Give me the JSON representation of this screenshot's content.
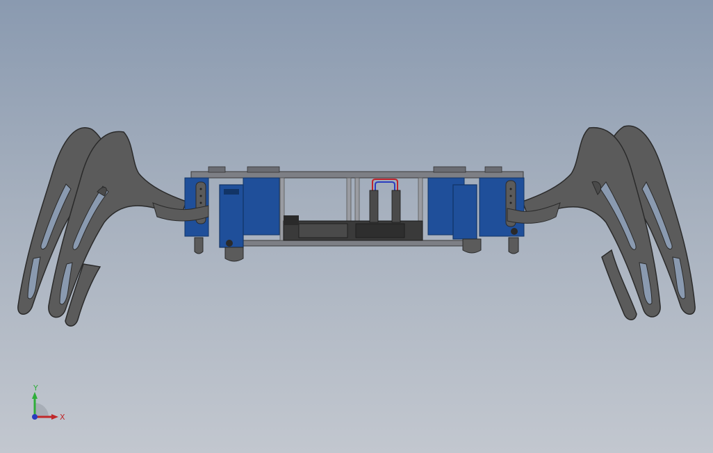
{
  "viewport": {
    "background_top": "#8a9ab0",
    "background_bottom": "#c2c7cf",
    "model": {
      "leg_color": "#5b5b5b",
      "leg_edge": "#2a2a2a",
      "servo_color": "#1f4f9a",
      "servo_dark": "#123466",
      "plate_color": "#7d7f85",
      "board_color": "#3a3a3a",
      "wire_red": "#c0232b",
      "wire_blue": "#2a3cc0"
    }
  },
  "triad": {
    "x_label": "X",
    "y_label": "Y",
    "x_color": "#c0282a",
    "y_color": "#2fae3a",
    "z_color": "#2a3cbf"
  }
}
